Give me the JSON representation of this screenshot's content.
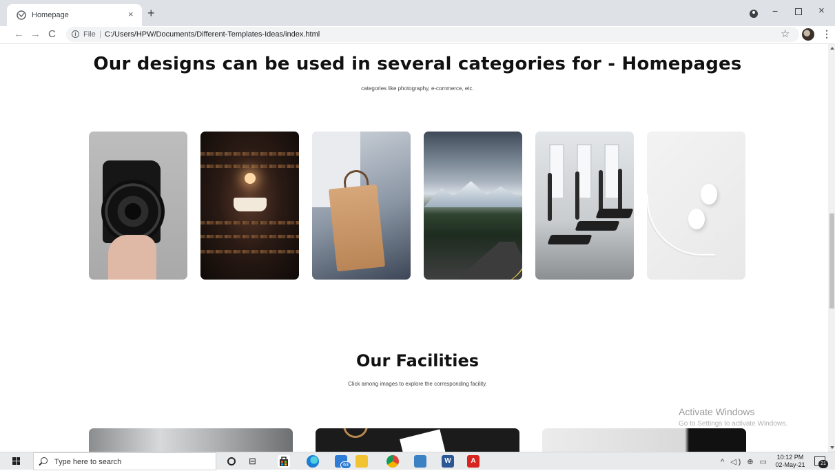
{
  "browser": {
    "tab_title": "Homepage",
    "tab_close": "×",
    "new_tab": "+",
    "url_scheme": "File",
    "url_sep": "|",
    "url": "C:/Users/HPW/Documents/Different-Templates-Ideas/index.html",
    "window_min": "−",
    "window_close": "×",
    "star": "☆",
    "menu": "⋮",
    "info": "i",
    "back": "←",
    "forward": "→",
    "reload": "C"
  },
  "page": {
    "hero_title": "Our designs can be used in several categories for - Homepages",
    "hero_subtitle": "categories like photography, e-commerce, etc.",
    "categories": [
      {
        "name": "photography",
        "icon": "camera"
      },
      {
        "name": "library",
        "icon": "books"
      },
      {
        "name": "shopping",
        "icon": "shopping-bag"
      },
      {
        "name": "travel",
        "icon": "mountain-road"
      },
      {
        "name": "fitness",
        "icon": "treadmill"
      },
      {
        "name": "electronics",
        "icon": "earphones"
      }
    ],
    "facilities_title": "Our Facilities",
    "facilities_subtitle": "Click among images to explore the corresponding facility."
  },
  "overlay": {
    "activate_title": "Activate Windows",
    "activate_sub": "Go to Settings to activate Windows."
  },
  "taskbar": {
    "search_placeholder": "Type here to search",
    "mail_badge": "63",
    "word_letter": "W",
    "acrobat_letter": "A",
    "time": "10:12 PM",
    "date": "02-May-21",
    "notifications": "21",
    "tray": "^ ◁) ⊕ ▭"
  },
  "colors": {
    "chrome_bg": "#dee1e6",
    "taskbar_bg": "#e9eaec",
    "heading": "#111111"
  }
}
